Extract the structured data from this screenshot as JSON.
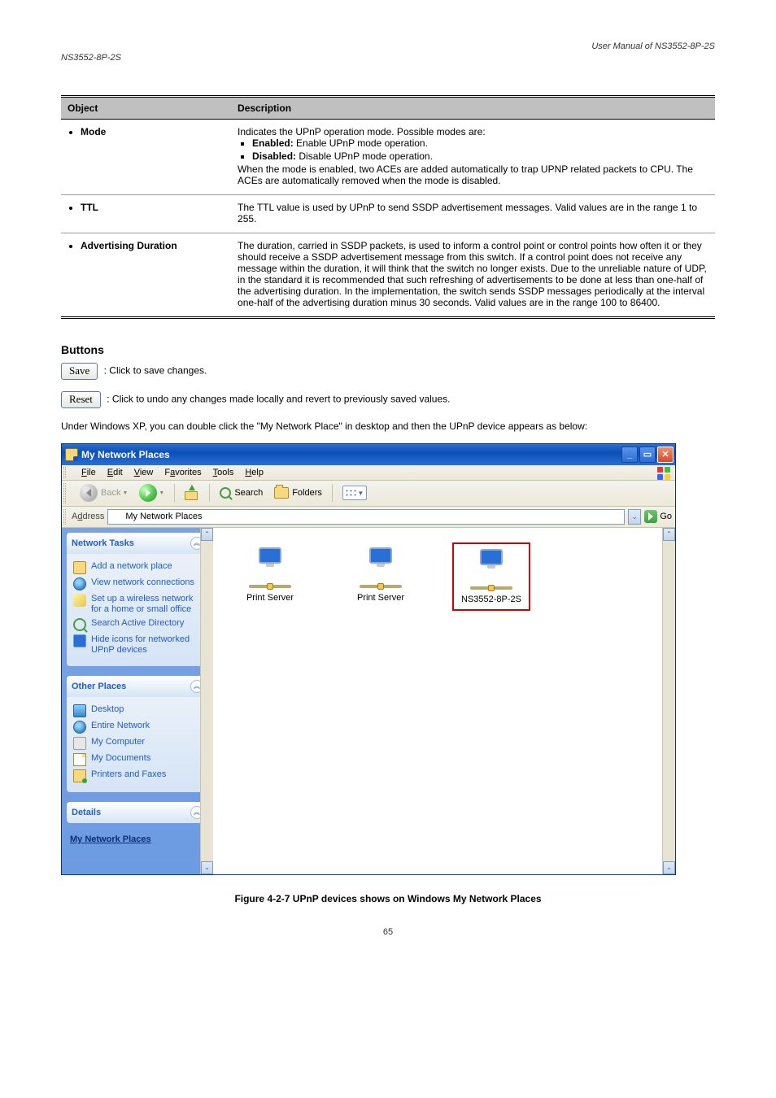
{
  "header": {
    "left": "NS3552-8P-2S",
    "right": "User Manual of NS3552-8P-2S"
  },
  "table": {
    "h1": "Object",
    "h2": "Description",
    "rows": [
      {
        "label": "Mode",
        "desc_lead": "Indicates the UPnP operation mode. Possible modes are:",
        "opts": [
          {
            "name": "Enabled:",
            "text": "Enable UPnP mode operation."
          },
          {
            "name": "Disabled:",
            "text": "Disable UPnP mode operation."
          }
        ],
        "desc_tail": "When the mode is enabled, two ACEs are added automatically to trap UPNP related packets to CPU. The ACEs are automatically removed when the mode is disabled."
      },
      {
        "label": "TTL",
        "desc": "The TTL value is used by UPnP to send SSDP advertisement messages. Valid values are in the range 1 to 255."
      },
      {
        "label": "Advertising Duration",
        "desc": "The duration, carried in SSDP packets, is used to inform a control point or control points how often it or they should receive a SSDP advertisement message from this switch. If a control point does not receive any message within the duration, it will think that the switch no longer exists. Due to the unreliable nature of UDP, in the standard it is recommended that such refreshing of advertisements to be done at less than one-half of the advertising duration. In the implementation, the switch sends SSDP messages periodically at the interval one-half of the advertising duration minus 30 seconds. Valid values are in the range 100 to 86400."
      }
    ]
  },
  "buttons_heading": "Buttons",
  "save_label": "Save",
  "save_text": ": Click to save changes.",
  "reset_label": "Reset",
  "reset_text": ": Click to undo any changes made locally and revert to previously saved values.",
  "explorer": {
    "title": "My Network Places",
    "menus": [
      "File",
      "Edit",
      "View",
      "Favorites",
      "Tools",
      "Help"
    ],
    "menu_under": [
      "F",
      "E",
      "V",
      "a",
      "T",
      "H"
    ],
    "tb": {
      "back": "Back",
      "search": "Search",
      "folders": "Folders"
    },
    "addr_label": "Address",
    "addr_value": "My Network Places",
    "go": "Go",
    "sidebar": {
      "p1": {
        "title": "Network Tasks",
        "items": [
          "Add a network place",
          "View network connections",
          "Set up a wireless network for a home or small office",
          "Search Active Directory",
          "Hide icons for networked UPnP devices"
        ]
      },
      "p2": {
        "title": "Other Places",
        "items": [
          "Desktop",
          "Entire Network",
          "My Computer",
          "My Documents",
          "Printers and Faxes"
        ]
      },
      "p3": {
        "title": "Details",
        "sub": "My Network Places"
      }
    },
    "devices": [
      "Print Server",
      "Print Server",
      "NS3552-8P-2S"
    ]
  },
  "figcap": "Figure 4-2-7 UPnP devices shows on Windows My Network Places",
  "pagenum": "65"
}
